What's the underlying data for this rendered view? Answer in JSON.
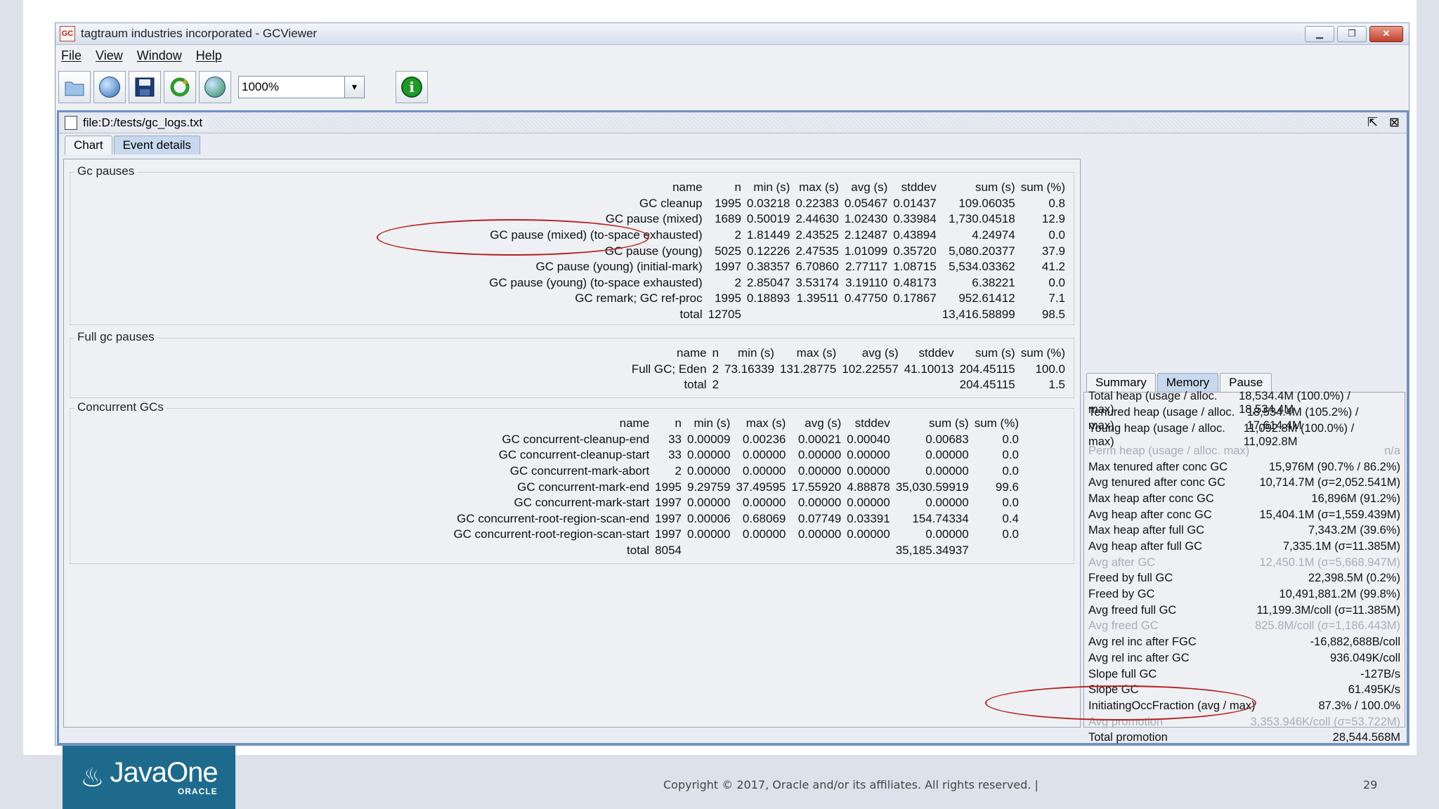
{
  "window": {
    "title": "tagtraum industries incorporated - GCViewer",
    "app_icon": "GC"
  },
  "menu": [
    "File",
    "View",
    "Window",
    "Help"
  ],
  "toolbar": {
    "zoom_value": "1000%"
  },
  "document": {
    "path": "file:D:/tests/gc_logs.txt",
    "tabs": [
      "Chart",
      "Event details"
    ],
    "selected_tab": "Event details"
  },
  "gc_pauses": {
    "title": "Gc pauses",
    "headers": [
      "name",
      "n",
      "min (s)",
      "max (s)",
      "avg (s)",
      "stddev",
      "sum (s)",
      "sum (%)"
    ],
    "rows": [
      [
        "GC cleanup",
        "1995",
        "0.03218",
        "0.22383",
        "0.05467",
        "0.01437",
        "109.06035",
        "0.8"
      ],
      [
        "GC pause (mixed)",
        "1689",
        "0.50019",
        "2.44630",
        "1.02430",
        "0.33984",
        "1,730.04518",
        "12.9"
      ],
      [
        "GC pause (mixed) (to-space exhausted)",
        "2",
        "1.81449",
        "2.43525",
        "2.12487",
        "0.43894",
        "4.24974",
        "0.0"
      ],
      [
        "GC pause (young)",
        "5025",
        "0.12226",
        "2.47535",
        "1.01099",
        "0.35720",
        "5,080.20377",
        "37.9"
      ],
      [
        "GC pause (young) (initial-mark)",
        "1997",
        "0.38357",
        "6.70860",
        "2.77117",
        "1.08715",
        "5,534.03362",
        "41.2"
      ],
      [
        "GC pause (young) (to-space exhausted)",
        "2",
        "2.85047",
        "3.53174",
        "3.19110",
        "0.48173",
        "6.38221",
        "0.0"
      ],
      [
        "GC remark; GC ref-proc",
        "1995",
        "0.18893",
        "1.39511",
        "0.47750",
        "0.17867",
        "952.61412",
        "7.1"
      ],
      [
        "total",
        "12705",
        "",
        "",
        "",
        "",
        "13,416.58899",
        "98.5"
      ]
    ]
  },
  "full_gc_pauses": {
    "title": "Full gc pauses",
    "headers": [
      "name",
      "n",
      "min (s)",
      "max (s)",
      "avg (s)",
      "stddev",
      "sum (s)",
      "sum (%)"
    ],
    "rows": [
      [
        "Full GC; Eden",
        "2",
        "73.16339",
        "131.28775",
        "102.22557",
        "41.10013",
        "204.45115",
        "100.0"
      ],
      [
        "total",
        "2",
        "",
        "",
        "",
        "",
        "204.45115",
        "1.5"
      ]
    ]
  },
  "concurrent_gcs": {
    "title": "Concurrent GCs",
    "headers": [
      "name",
      "n",
      "min (s)",
      "max (s)",
      "avg (s)",
      "stddev",
      "sum (s)",
      "sum (%)"
    ],
    "rows": [
      [
        "GC concurrent-cleanup-end",
        "33",
        "0.00009",
        "0.00236",
        "0.00021",
        "0.00040",
        "0.00683",
        "0.0"
      ],
      [
        "GC concurrent-cleanup-start",
        "33",
        "0.00000",
        "0.00000",
        "0.00000",
        "0.00000",
        "0.00000",
        "0.0"
      ],
      [
        "GC concurrent-mark-abort",
        "2",
        "0.00000",
        "0.00000",
        "0.00000",
        "0.00000",
        "0.00000",
        "0.0"
      ],
      [
        "GC concurrent-mark-end",
        "1995",
        "9.29759",
        "37.49595",
        "17.55920",
        "4.88878",
        "35,030.59919",
        "99.6"
      ],
      [
        "GC concurrent-mark-start",
        "1997",
        "0.00000",
        "0.00000",
        "0.00000",
        "0.00000",
        "0.00000",
        "0.0"
      ],
      [
        "GC concurrent-root-region-scan-end",
        "1997",
        "0.00006",
        "0.68069",
        "0.07749",
        "0.03391",
        "154.74334",
        "0.4"
      ],
      [
        "GC concurrent-root-region-scan-start",
        "1997",
        "0.00000",
        "0.00000",
        "0.00000",
        "0.00000",
        "0.00000",
        "0.0"
      ],
      [
        "total",
        "8054",
        "",
        "",
        "",
        "",
        "35,185.34937",
        ""
      ]
    ]
  },
  "side_panel": {
    "tabs": [
      "Summary",
      "Memory",
      "Pause"
    ],
    "selected_tab": "Memory",
    "rows": [
      {
        "label": "Total heap (usage / alloc. max)",
        "value": "18,534.4M (100.0%) / 18,534.4M",
        "disabled": false
      },
      {
        "label": "Tenured heap (usage / alloc. max)",
        "value": "18,534.4M (105.2%) / 17,614.4M",
        "disabled": false
      },
      {
        "label": "Young heap (usage / alloc. max)",
        "value": "11,092.8M (100.0%) / 11,092.8M",
        "disabled": false
      },
      {
        "label": "Perm heap (usage / alloc. max)",
        "value": "n/a",
        "disabled": true
      },
      {
        "label": "Max tenured after conc GC",
        "value": "15,976M (90.7% / 86.2%)",
        "disabled": false
      },
      {
        "label": "Avg tenured after conc GC",
        "value": "10,714.7M (σ=2,052.541M)",
        "disabled": false
      },
      {
        "label": "Max heap after conc GC",
        "value": "16,896M (91.2%)",
        "disabled": false
      },
      {
        "label": "Avg heap after conc GC",
        "value": "15,404.1M (σ=1,559.439M)",
        "disabled": false
      },
      {
        "label": "Max heap after full GC",
        "value": "7,343.2M (39.6%)",
        "disabled": false
      },
      {
        "label": "Avg heap after full GC",
        "value": "7,335.1M (σ=11.385M)",
        "disabled": false
      },
      {
        "label": "Avg after GC",
        "value": "12,450.1M (σ=5,668.947M)",
        "disabled": true
      },
      {
        "label": "Freed by full GC",
        "value": "22,398.5M (0.2%)",
        "disabled": false
      },
      {
        "label": "Freed by GC",
        "value": "10,491,881.2M (99.8%)",
        "disabled": false
      },
      {
        "label": "Avg freed full GC",
        "value": "11,199.3M/coll (σ=11.385M)",
        "disabled": false
      },
      {
        "label": "Avg freed GC",
        "value": "825.8M/coll (σ=1,186.443M)",
        "disabled": true
      },
      {
        "label": "Avg rel inc after FGC",
        "value": "-16,882,688B/coll",
        "disabled": false
      },
      {
        "label": "Avg rel inc after GC",
        "value": "936.049K/coll",
        "disabled": false
      },
      {
        "label": "Slope full GC",
        "value": "-127B/s",
        "disabled": false
      },
      {
        "label": "Slope GC",
        "value": "61.495K/s",
        "disabled": false
      },
      {
        "label": "InitiatingOccFraction (avg / max)",
        "value": "87.3% / 100.0%",
        "disabled": false
      },
      {
        "label": "Avg promotion",
        "value": "3,353.946K/coll (σ=53.722M)",
        "disabled": true
      },
      {
        "label": "Total promotion",
        "value": "28,544.568M",
        "disabled": false
      }
    ]
  },
  "footer": {
    "logo_text": "JavaOne",
    "logo_sub": "ORACLE",
    "copyright": "Copyright © 2017, Oracle and/or its affiliates. All rights reserved.  |",
    "page_number": "29"
  },
  "colors": {
    "accent": "#6f8fc8",
    "annotation_oval": "#b42020",
    "logo_bg": "#1d6a8c"
  }
}
